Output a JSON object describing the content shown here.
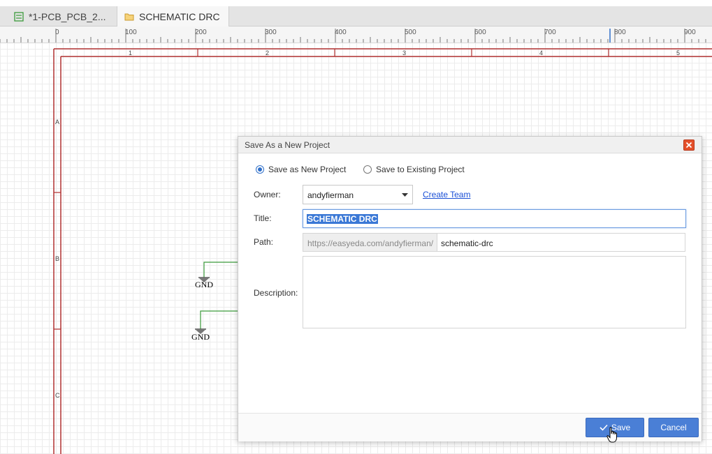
{
  "tabs": [
    {
      "label": "*1-PCB_PCB_2...",
      "icon": "pcb-icon",
      "active": false
    },
    {
      "label": "SCHEMATIC DRC",
      "icon": "folder-icon",
      "active": true
    }
  ],
  "ruler": {
    "labels": [
      "0",
      "100",
      "200",
      "300",
      "400",
      "500",
      "600",
      "700",
      "800",
      "900"
    ]
  },
  "schematic": {
    "column_labels": [
      "1",
      "2",
      "3",
      "4",
      "5"
    ],
    "row_labels": [
      "A",
      "B",
      "C"
    ],
    "gnd_labels": [
      "GND",
      "GND"
    ],
    "colors": {
      "frame": "#b03030",
      "wire": "#3a9a3a"
    }
  },
  "dialog": {
    "title": "Save As a New Project",
    "radio_new": "Save as New Project",
    "radio_existing": "Save to Existing Project",
    "owner_label": "Owner:",
    "owner_value": "andyfierman",
    "create_team": "Create Team",
    "title_label": "Title:",
    "title_value": "SCHEMATIC DRC",
    "path_label": "Path:",
    "path_prefix": "https://easyeda.com/andyfierman/",
    "path_value": "schematic-drc",
    "description_label": "Description:",
    "save_label": "Save",
    "cancel_label": "Cancel",
    "accent": "#4a7fd6"
  }
}
